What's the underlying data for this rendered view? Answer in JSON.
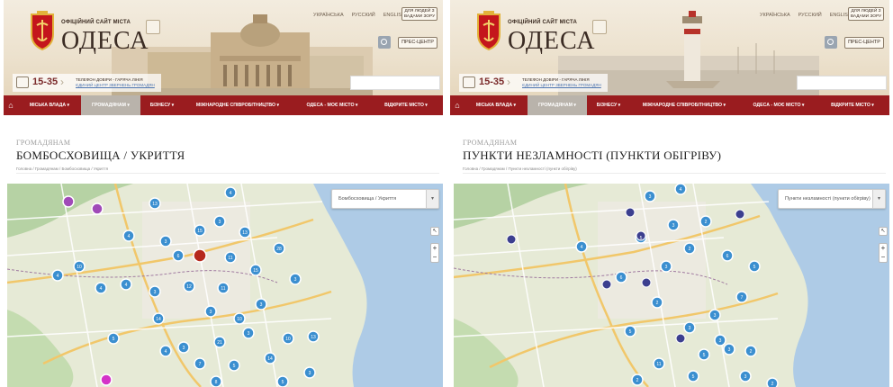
{
  "colors": {
    "nav": "#9a1c1f",
    "nav_active": "#b9b3ab",
    "cluster": "#3b8fd0",
    "shelter_special": "#a04ab8",
    "alert": "#b6281c",
    "warming_point": "#3c3f8f",
    "water": "#a9c8e4"
  },
  "screens": [
    {
      "header": {
        "site_label": "ОФІЦІЙНИЙ САЙТ МІСТА",
        "city": "ОДЕСА",
        "languages": [
          "УКРАЇНСЬКА",
          "РУССКИЙ",
          "ENGLISH"
        ],
        "impaired_button": "ДЛЯ ЛЮДЕЙ З ВАДАМИ ЗОРУ",
        "press_button": "ПРЕС-ЦЕНТР",
        "hotline": {
          "number": "15-35",
          "line1": "ТЕЛЕФОН ДОВІРИ - ГАРЯЧА ЛІНІЯ",
          "line2": "ЄДИНИЙ ЦЕНТР ЗВЕРНЕНЬ ГРОМАДЯН"
        }
      },
      "nav": [
        "МІСЬКА ВЛАДА ▾",
        "ГРОМАДЯНАМ ▾",
        "БІЗНЕСУ ▾",
        "МІЖНАРОДНЕ СПІВРОБІТНИЦТВО ▾",
        "ОДЕСА - МОЄ МІСТО ▾",
        "ВІДКРИТЕ МІСТО ▾"
      ],
      "section": "ГРОМАДЯНАМ",
      "title": "БОМБОСХОВИЩА / УКРИТТЯ",
      "breadcrumbs": "Головна / Громадянам / Бомбосховища / Укриття",
      "map_select": "Бомбосховища / Укриття",
      "clusters": [
        "4",
        "13",
        "3",
        "4",
        "15",
        "3",
        "13",
        "6",
        "11",
        "28",
        "15",
        "4",
        "10",
        "4",
        "4",
        "12",
        "11",
        "3",
        "3",
        "3",
        "3",
        "14",
        "10",
        "3",
        "5",
        "21",
        "10",
        "13",
        "4",
        "7",
        "5",
        "14",
        "3",
        "8",
        "5",
        "3",
        "3",
        "13",
        "4",
        "6",
        "5",
        "16",
        "12",
        "17",
        "14",
        "10",
        "3"
      ]
    },
    {
      "header": {
        "site_label": "ОФІЦІЙНИЙ САЙТ МІСТА",
        "city": "ОДЕСА",
        "languages": [
          "УКРАЇНСЬКА",
          "РУССКИЙ",
          "ENGLISH"
        ],
        "impaired_button": "ДЛЯ ЛЮДЕЙ З ВАДАМИ ЗОРУ",
        "press_button": "ПРЕС-ЦЕНТР",
        "hotline": {
          "number": "15-35",
          "line1": "ТЕЛЕФОН ДОВІРИ - ГАРЯЧА ЛІНІЯ",
          "line2": "ЄДИНИЙ ЦЕНТР ЗВЕРНЕНЬ ГРОМАДЯН"
        }
      },
      "nav": [
        "МІСЬКА ВЛАДА ▾",
        "ГРОМАДЯНАМ ▾",
        "БІЗНЕСУ ▾",
        "МІЖНАРОДНЕ СПІВРОБІТНИЦТВО ▾",
        "ОДЕСА - МОЄ МІСТО ▾",
        "ВІДКРИТЕ МІСТО ▾"
      ],
      "section": "ГРОМАДЯНАМ",
      "title": "ПУНКТИ НЕЗЛАМНОСТІ (ПУНКТИ ОБІГРІВУ)",
      "breadcrumbs": "Головна / Громадянам / Пункти незламності (пункти обігріву)",
      "map_select": "Пункти незламності (пункти обігріву)",
      "clusters": [
        "4",
        "3",
        "2",
        "3",
        "5",
        "2",
        "4",
        "3",
        "6",
        "5",
        "6",
        "7",
        "2",
        "3",
        "5",
        "3",
        "3",
        "5",
        "3",
        "11",
        "5",
        "2",
        "3",
        "2",
        "2",
        "3",
        "3"
      ]
    }
  ]
}
